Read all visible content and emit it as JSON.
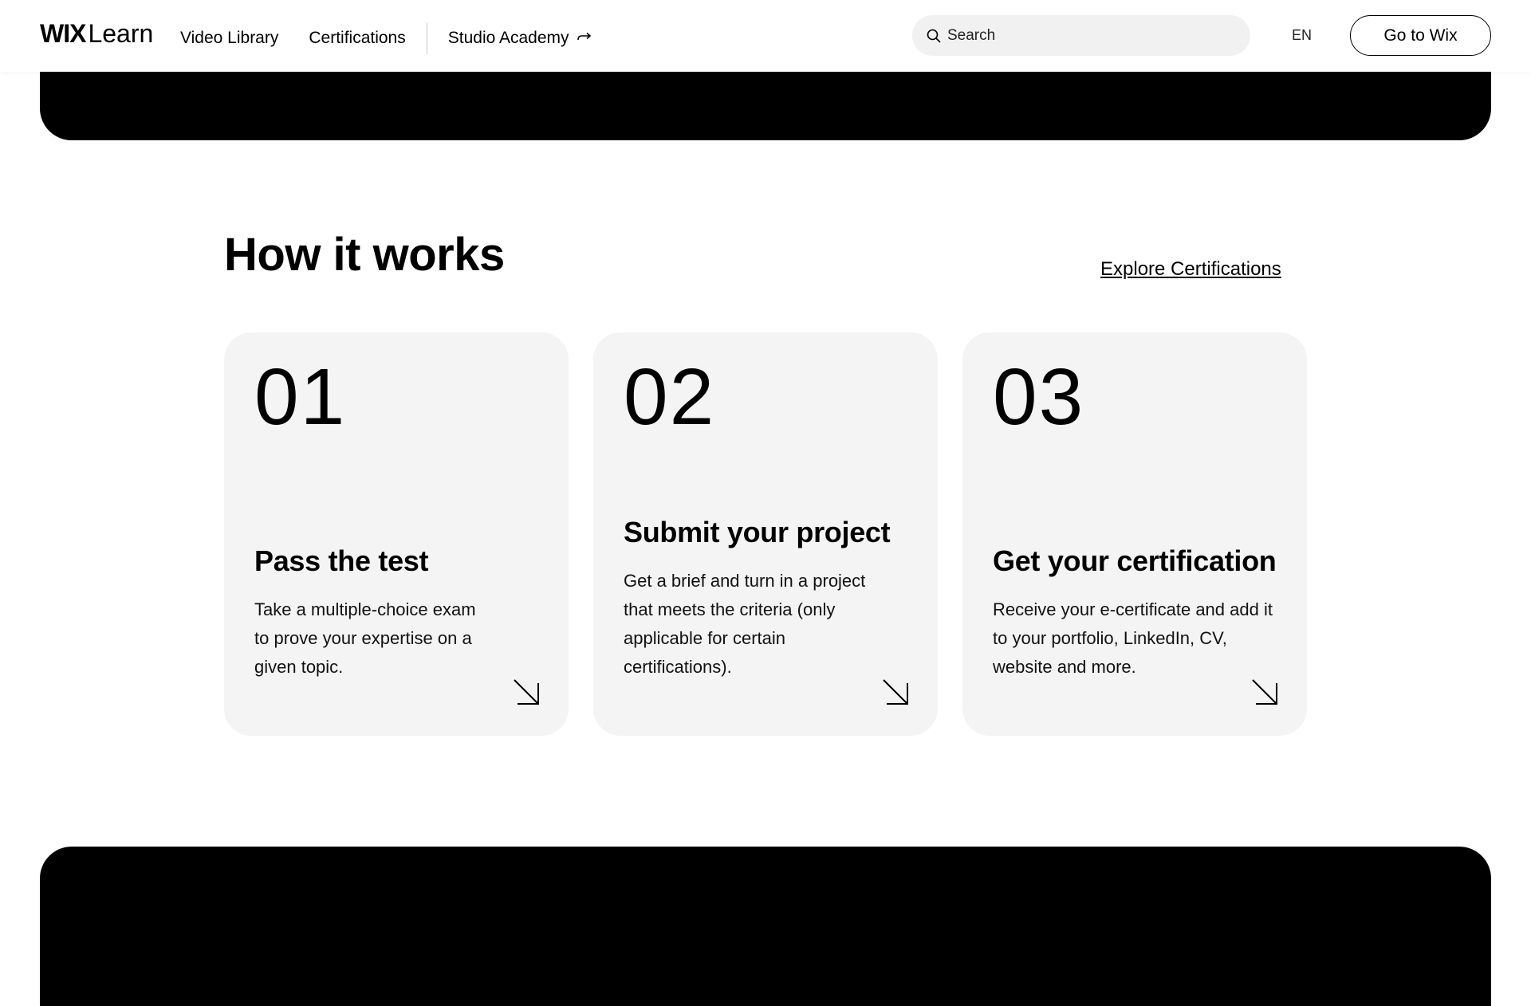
{
  "header": {
    "logo_wix": "WIX",
    "logo_learn": "Learn",
    "nav": {
      "video_library": "Video Library",
      "certifications": "Certifications",
      "studio_academy": "Studio Academy"
    },
    "search": {
      "placeholder": "Search"
    },
    "language": "EN",
    "go_to_wix": "Go to Wix"
  },
  "how_it_works": {
    "title": "How it works",
    "explore_link": "Explore Certifications",
    "steps": [
      {
        "number": "01",
        "title": "Pass the test",
        "text": "Take a multiple-choice exam to prove your expertise on a given topic."
      },
      {
        "number": "02",
        "title": "Submit your project",
        "text": "Get a brief and turn in a project that meets the criteria (only applicable for certain certifications)."
      },
      {
        "number": "03",
        "title": "Get your certification",
        "text": "Receive your e-certificate and add it to your portfolio, LinkedIn, CV, website and more."
      }
    ]
  },
  "bottom_banner": {
    "heading_accent": "",
    "heading_rest": ""
  },
  "colors": {
    "background": "#ffffff",
    "card_background": "#f4f4f4",
    "banner": "#000000",
    "accent": "#f2c14e",
    "search_background": "#f1f1f1"
  },
  "icons": {
    "search": "search-icon",
    "studio_arrow": "arrow-right-icon",
    "card_arrow": "arrow-down-right-icon"
  }
}
